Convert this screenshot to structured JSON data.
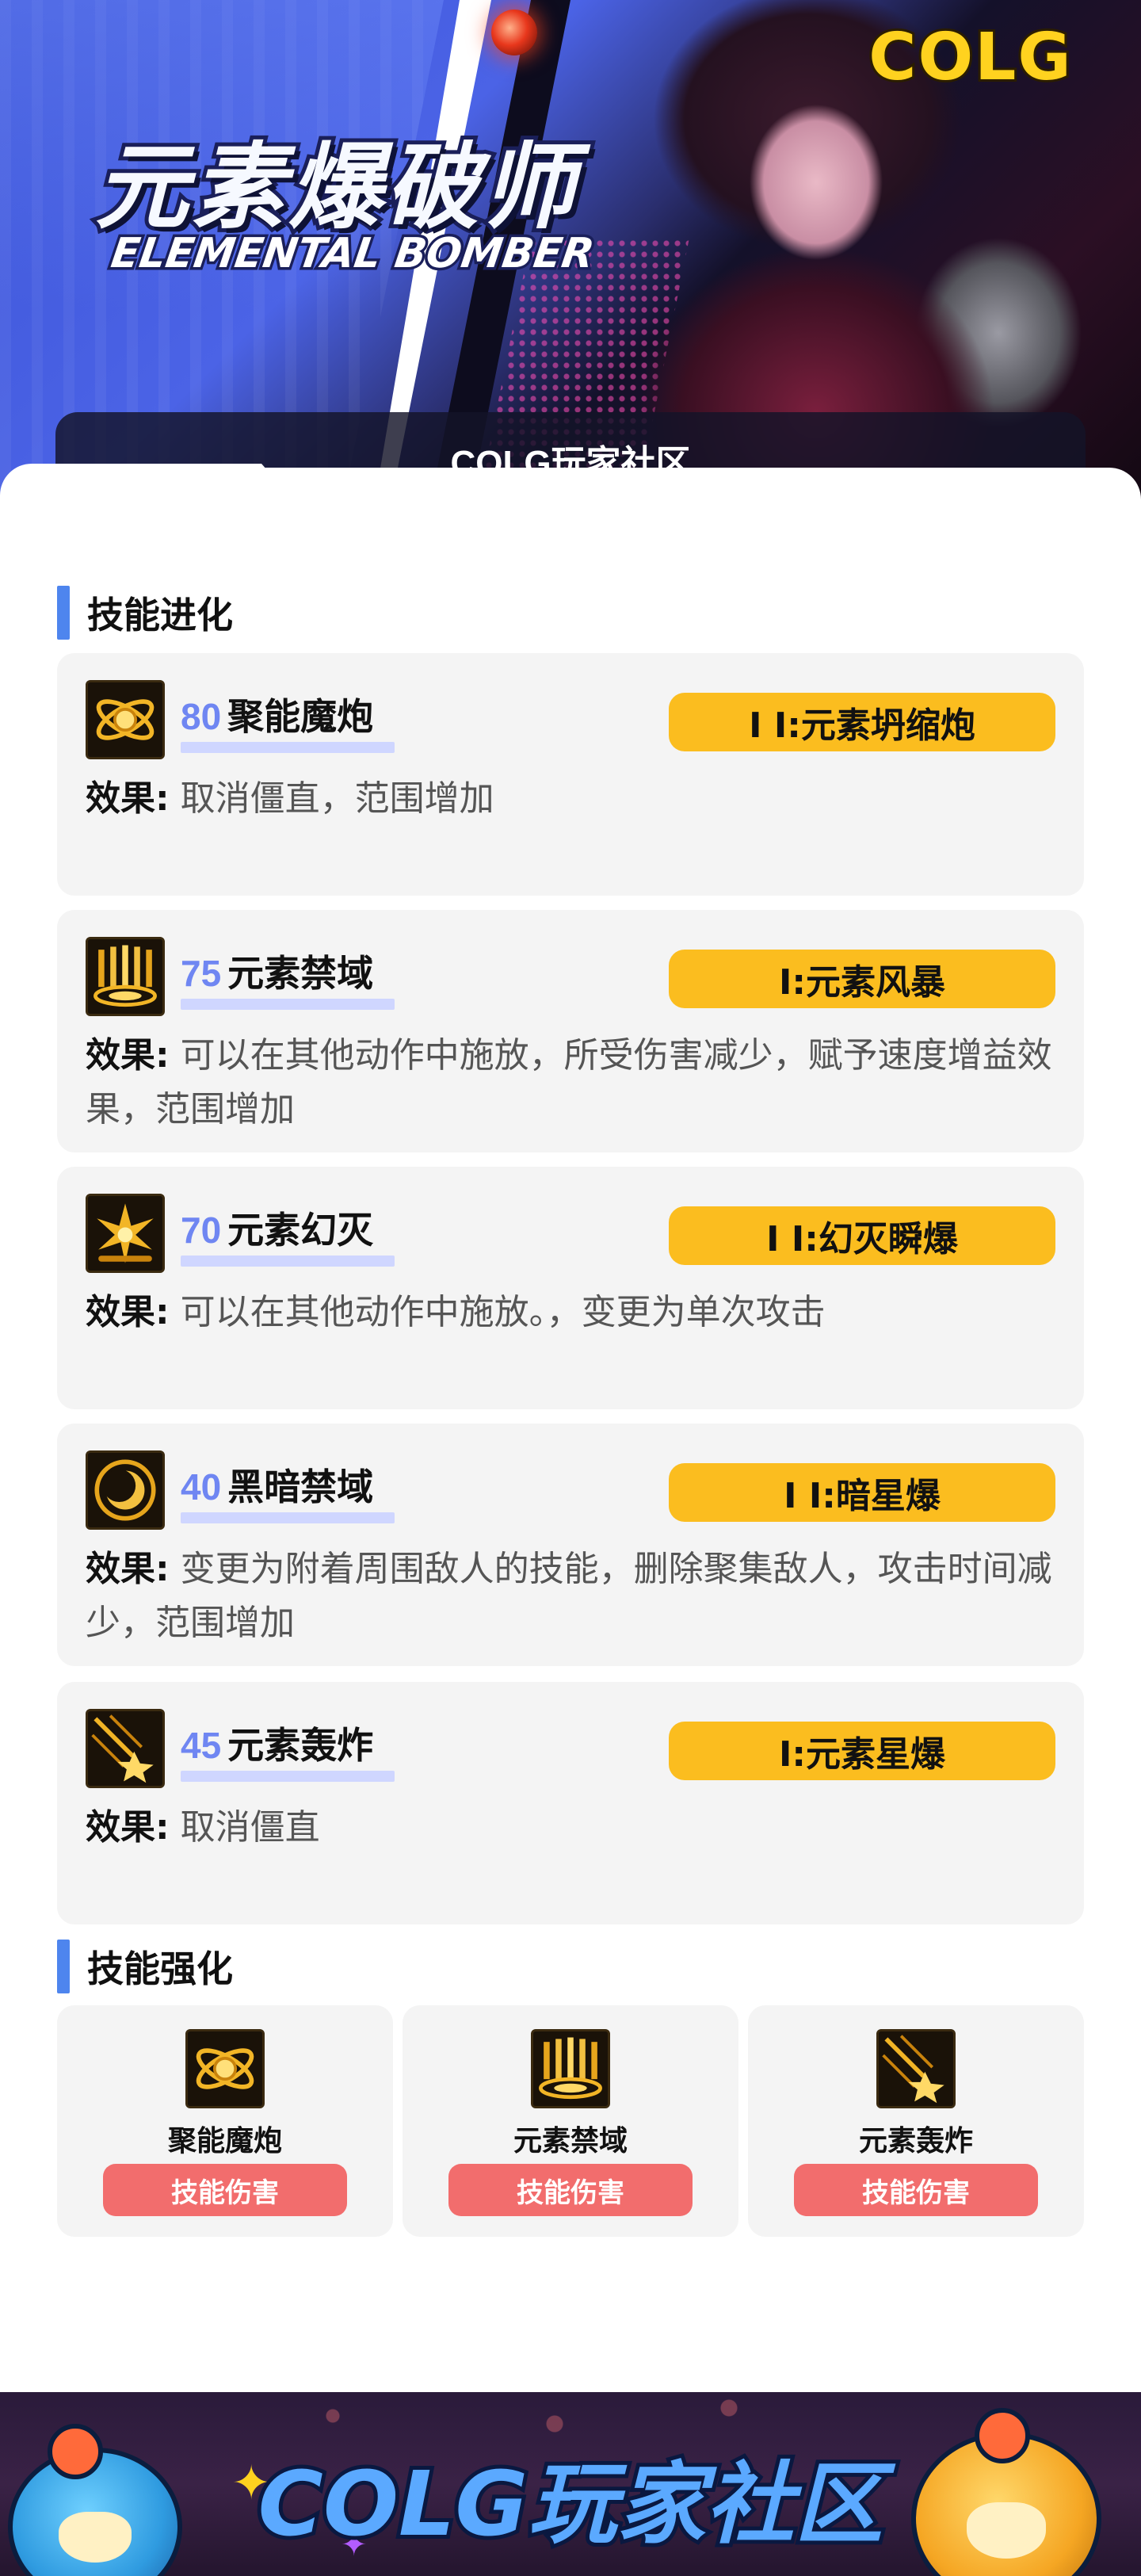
{
  "banner": {
    "logo_text": "COLG",
    "title_cn": "元素爆破师",
    "title_en": "ELEMENTAL BOMBER",
    "caption": "COLG玩家社区"
  },
  "evolution": {
    "heading": "技能进化",
    "effect_label": "效果:",
    "skills": [
      {
        "level": "80",
        "name": "聚能魔炮",
        "evolution": "Ⅰ Ⅰ:元素坍缩炮",
        "effect": "取消僵直，范围增加",
        "icon": "atom-orb-icon"
      },
      {
        "level": "75",
        "name": "元素禁域",
        "evolution": "Ⅰ:元素风暴",
        "effect": "可以在其他动作中施放，所受伤害减少，赋予速度增益效果，范围增加",
        "icon": "golden-pillars-icon"
      },
      {
        "level": "70",
        "name": "元素幻灭",
        "evolution": "Ⅰ Ⅰ:幻灭瞬爆",
        "effect": "可以在其他动作中施放。，变更为单次攻击",
        "icon": "burst-icon"
      },
      {
        "level": "40",
        "name": "黑暗禁域",
        "evolution": "Ⅰ Ⅰ:暗星爆",
        "effect": "变更为附着周围敌人的技能，删除聚集敌人，攻击时间减少，范围增加",
        "icon": "dark-sphere-icon"
      },
      {
        "level": "45",
        "name": "元素轰炸",
        "evolution": "Ⅰ:元素星爆",
        "effect": "取消僵直",
        "icon": "meteor-icon"
      }
    ]
  },
  "enhance": {
    "heading": "技能强化",
    "tiles": [
      {
        "name": "聚能魔炮",
        "button": "技能伤害",
        "icon": "atom-orb-icon"
      },
      {
        "name": "元素禁域",
        "button": "技能伤害",
        "icon": "golden-pillars-icon"
      },
      {
        "name": "元素轰炸",
        "button": "技能伤害",
        "icon": "meteor-icon"
      }
    ]
  },
  "footer": {
    "title": "COLG玩家社区"
  },
  "colors": {
    "accent_blue": "#4e85ee",
    "level_blue": "#6f86f2",
    "evolution_pill": "#fbbd1f",
    "damage_button": "#f26d6d",
    "card_background": "#f4f4f4"
  }
}
